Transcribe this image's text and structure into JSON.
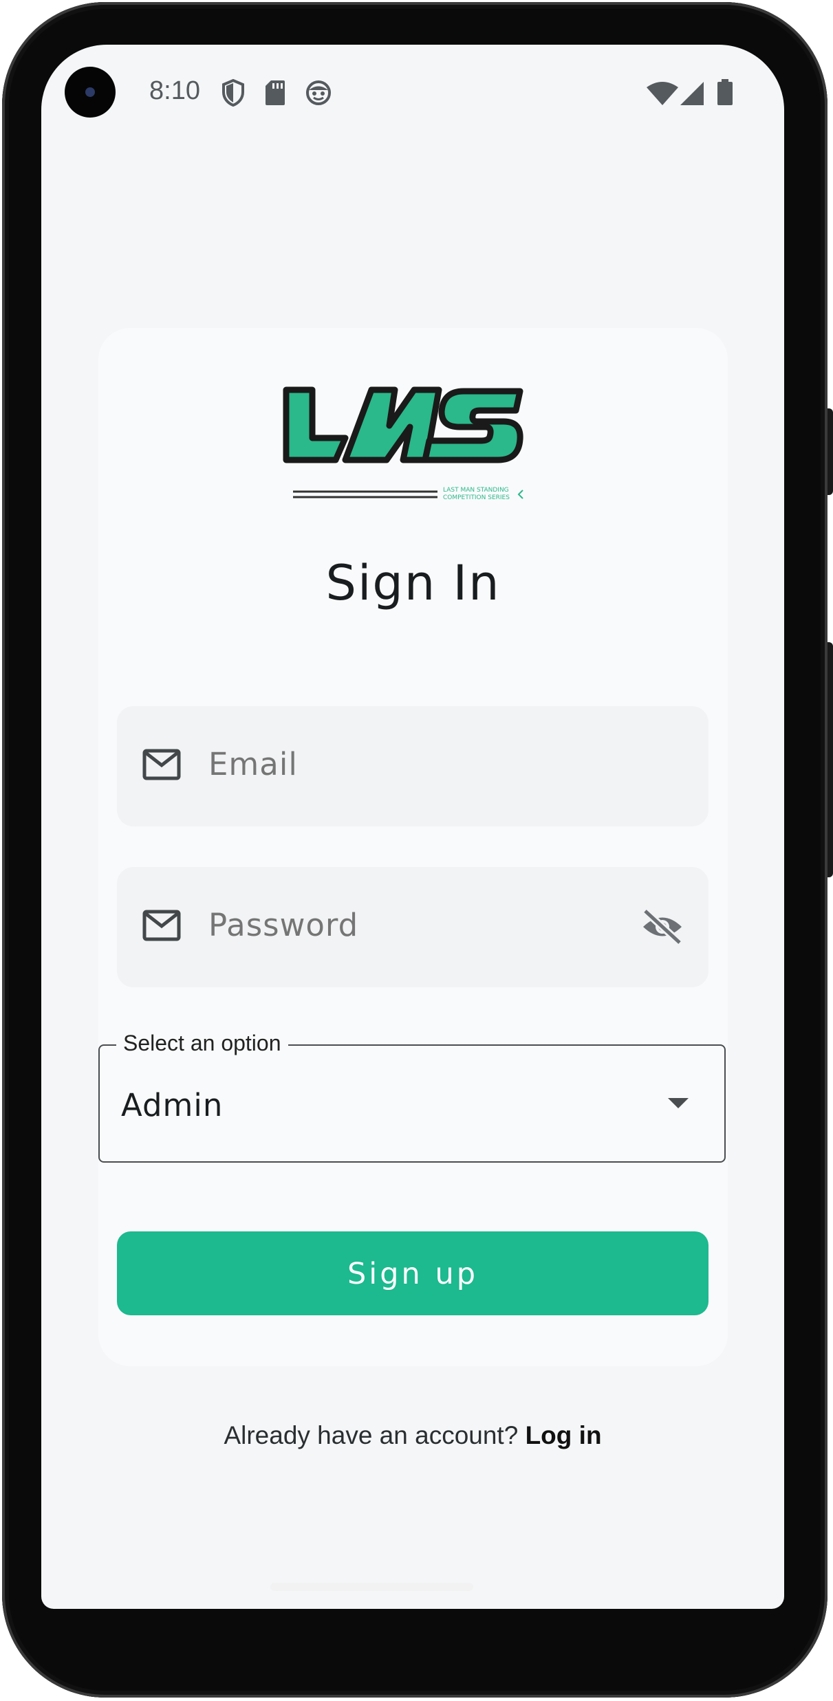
{
  "status_bar": {
    "time": "8:10",
    "left_icons": [
      "shield-icon",
      "sd-card-icon",
      "face-icon"
    ],
    "right_icons": [
      "wifi-icon",
      "cell-signal-icon",
      "battery-icon"
    ]
  },
  "logo": {
    "text": "LMS",
    "tagline_line1": "LAST MAN STANDING",
    "tagline_line2": "COMPETITION SERIES",
    "color": "#2bb88a"
  },
  "form": {
    "title": "Sign In",
    "email_placeholder": "Email",
    "password_placeholder": "Password",
    "role_label": "Select an option",
    "role_value": "Admin",
    "submit_label": "Sign up"
  },
  "footer": {
    "prompt": "Already have an account?",
    "link": "Log in"
  },
  "colors": {
    "accent": "#1db98f",
    "background": "#f4f6f7",
    "card": "#f9fafb"
  }
}
